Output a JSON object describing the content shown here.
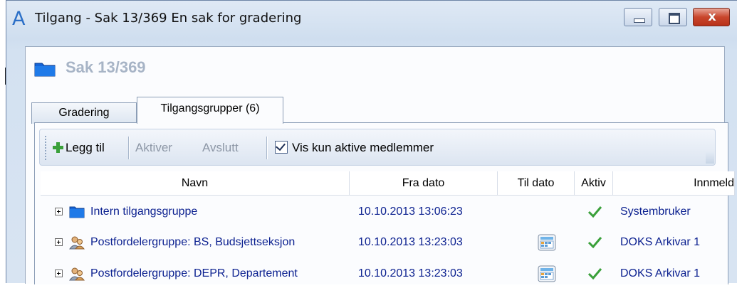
{
  "window": {
    "app_icon": "A",
    "title": "Tilgang - Sak 13/369 En sak for gradering",
    "controls": {
      "minimize": "minimize-icon",
      "maximize": "maximize-icon",
      "close_symbol": "x"
    }
  },
  "case": {
    "title": "Sak 13/369",
    "icon": "folder-icon"
  },
  "tabs": [
    {
      "label": "Gradering",
      "selected": false
    },
    {
      "label": "Tilgangsgrupper (6)",
      "selected": true
    }
  ],
  "toolbar": {
    "add_label": "Legg til",
    "activate_label": "Aktiver",
    "end_label": "Avslutt",
    "show_active_label": "Vis kun aktive medlemmer",
    "show_active_checked": true
  },
  "grid": {
    "columns": [
      "Navn",
      "Fra dato",
      "Til dato",
      "Aktiv",
      "Innmeld"
    ],
    "rows": [
      {
        "name": "Intern tilgangsgruppe",
        "icon": "folder-icon",
        "from": "10.10.2013 13:06:23",
        "to_icon": "",
        "active": true,
        "registered_by": "Systembruker"
      },
      {
        "name": "Postfordelergruppe: BS, Budsjettseksjon",
        "icon": "users-icon",
        "from": "10.10.2013 13:23:03",
        "to_icon": "calendar-icon",
        "active": true,
        "registered_by": "DOKS Arkivar 1"
      },
      {
        "name": "Postfordelergruppe: DEPR, Departement",
        "icon": "users-icon",
        "from": "10.10.2013 13:23:03",
        "to_icon": "calendar-icon",
        "active": true,
        "registered_by": "DOKS Arkivar 1"
      }
    ]
  },
  "colors": {
    "link_blue": "#0a1f8f",
    "check_green": "#3aa03a",
    "disabled_text": "#8d97a6"
  }
}
